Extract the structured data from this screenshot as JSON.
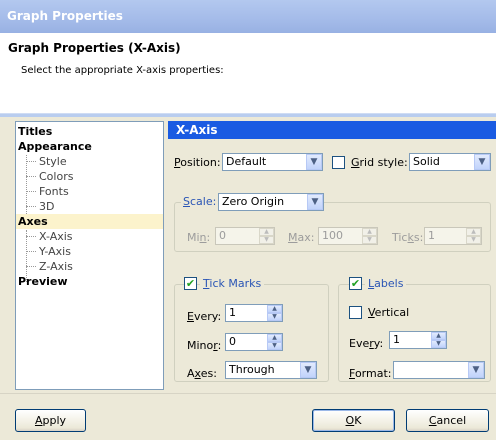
{
  "window": {
    "title": "Graph Properties"
  },
  "header": {
    "title": "Graph Properties (X-Axis)",
    "subtitle": "Select the appropriate X-axis properties:"
  },
  "nav": {
    "titles": "Titles",
    "appearance": "Appearance",
    "style": "Style",
    "colors": "Colors",
    "fonts": "Fonts",
    "d3": "3D",
    "axes": "Axes",
    "xaxis": "X-Axis",
    "yaxis": "Y-Axis",
    "zaxis": "Z-Axis",
    "preview": "Preview"
  },
  "panel": {
    "title": "X-Axis",
    "position": {
      "label_acc": "P",
      "label_rest": "osition:",
      "value": "Default"
    },
    "grid": {
      "label_acc": "G",
      "label_rest": "rid style:",
      "value": "Solid",
      "checked": false
    },
    "scale": {
      "label_acc": "S",
      "label_rest": "cale:",
      "value": "Zero Origin",
      "min": {
        "label_pre": "Mi",
        "label_acc": "n",
        "label_rest": ":",
        "value": "0"
      },
      "max": {
        "label_acc": "M",
        "label_rest": "ax:",
        "value": "100"
      },
      "ticks": {
        "label_pre": "Tic",
        "label_acc": "k",
        "label_rest": "s:",
        "value": "1"
      }
    },
    "tick_marks": {
      "label_acc": "T",
      "label_rest": "ick Marks",
      "checked": true,
      "every": {
        "label_acc": "E",
        "label_rest": "very:",
        "value": "1"
      },
      "minor": {
        "label_pre": "Mino",
        "label_acc": "r",
        "label_rest": ":",
        "value": "0"
      },
      "axes": {
        "label_pre": "A",
        "label_acc": "x",
        "label_rest": "es:",
        "value": "Through"
      }
    },
    "labels": {
      "label_acc": "L",
      "label_rest": "abels",
      "checked": true,
      "vertical": {
        "label_acc": "V",
        "label_rest": "ertical",
        "checked": false
      },
      "every": {
        "label_pre": "Eve",
        "label_acc": "r",
        "label_rest": "y:",
        "value": "1"
      },
      "format": {
        "label_acc": "F",
        "label_rest": "ormat:",
        "value": ""
      }
    }
  },
  "buttons": {
    "apply": {
      "acc": "A",
      "rest": "pply"
    },
    "ok": {
      "acc": "O",
      "rest": "K"
    },
    "cancel": {
      "acc": "C",
      "rest": "ancel"
    }
  },
  "glyphs": {
    "check": "✔",
    "dropdown": "▼",
    "up": "▲",
    "down": "▼"
  }
}
